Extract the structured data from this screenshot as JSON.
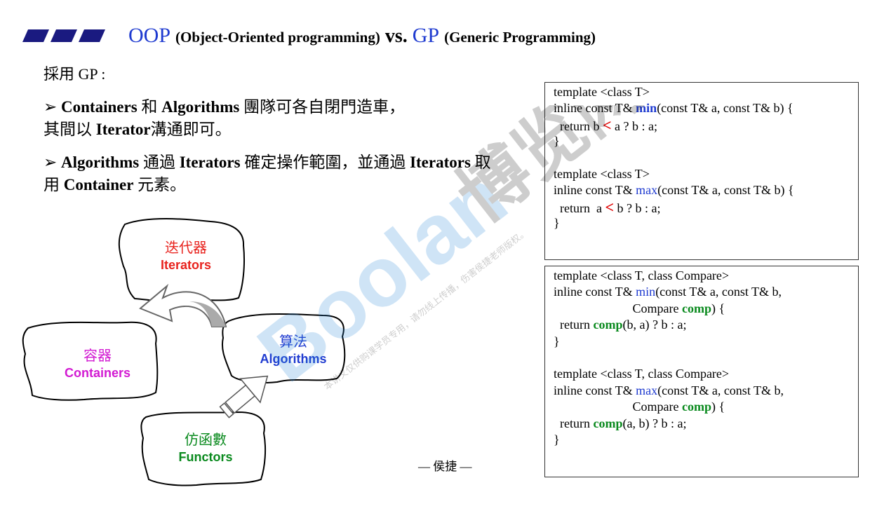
{
  "header": {
    "oop": "OOP",
    "oop_full": "(Object-Oriented programming)",
    "vs": "vs.",
    "gp": "GP",
    "gp_full": "(Generic Programming)"
  },
  "subhead": "採用 GP :",
  "bullets": [
    {
      "marker": "➢",
      "parts": [
        {
          "t": "Containers",
          "b": true
        },
        {
          "t": " 和 ",
          "b": false
        },
        {
          "t": "Algorithms",
          "b": true
        },
        {
          "t": " 團隊可各自閉門造車，其間以 ",
          "b": false
        },
        {
          "t": "Iterator",
          "b": true
        },
        {
          "t": "溝通即可。",
          "b": false
        }
      ]
    },
    {
      "marker": "➢",
      "parts": [
        {
          "t": "Algorithms",
          "b": true
        },
        {
          "t": " 通過 ",
          "b": false
        },
        {
          "t": "Iterators",
          "b": true
        },
        {
          "t": " 確定操作範圍，並通過 ",
          "b": false
        },
        {
          "t": "Iterators",
          "b": true
        },
        {
          "t": " 取用 ",
          "b": false
        },
        {
          "t": "Container",
          "b": true
        },
        {
          "t": " 元素。",
          "b": false
        }
      ]
    }
  ],
  "diagram": {
    "iterators": {
      "zh": "迭代器",
      "en": "Iterators",
      "color": "#e8231e"
    },
    "containers": {
      "zh": "容器",
      "en": "Containers",
      "color": "#d21ad2"
    },
    "algorithms": {
      "zh": "算法",
      "en": "Algorithms",
      "color": "#1f3bd0"
    },
    "functors": {
      "zh": "仿函數",
      "en": "Functors",
      "color": "#0a8a1e"
    }
  },
  "author": "— 侯捷 —",
  "code1": {
    "min": {
      "l1": "template <class T>",
      "l2a": "inline const T& ",
      "l2fn": "min",
      "l2b": "(const T& a, const T& b) {",
      "l3a": "  return b ",
      "l3op": "<",
      "l3b": " a ? b : a;",
      "l4": "}"
    },
    "max": {
      "l1": "template <class T>",
      "l2a": "inline const T& ",
      "l2fn": "max",
      "l2b": "(const T& a, const T& b) {",
      "l3a": "  return  a ",
      "l3op": "<",
      "l3b": " b ? b : a;",
      "l4": "}"
    }
  },
  "code2": {
    "min": {
      "l1": "template <class T, class Compare>",
      "l2a": "inline const T& ",
      "l2fn": "min",
      "l2b": "(const T& a, const T& b,",
      "l3a": "                         Compare ",
      "l3kw": "comp",
      "l3b": ") {",
      "l4a": "  return ",
      "l4kw": "comp",
      "l4b": "(b, a) ? b : a;",
      "l5": "}"
    },
    "max": {
      "l1": "template <class T, class Compare>",
      "l2a": "inline const T& ",
      "l2fn": "max",
      "l2b": "(const T& a, const T& b,",
      "l3a": "                         Compare ",
      "l3kw": "comp",
      "l3b": ") {",
      "l4a": "  return ",
      "l4kw": "comp",
      "l4b": "(a, b) ? b : a;",
      "l5": "}"
    }
  },
  "watermark": {
    "brand": "Boolan",
    "brand_zh": "博览网",
    "notice": "本讲义仅供购课学员专用，请勿线上传播，伤害侯捷老师版权。"
  }
}
